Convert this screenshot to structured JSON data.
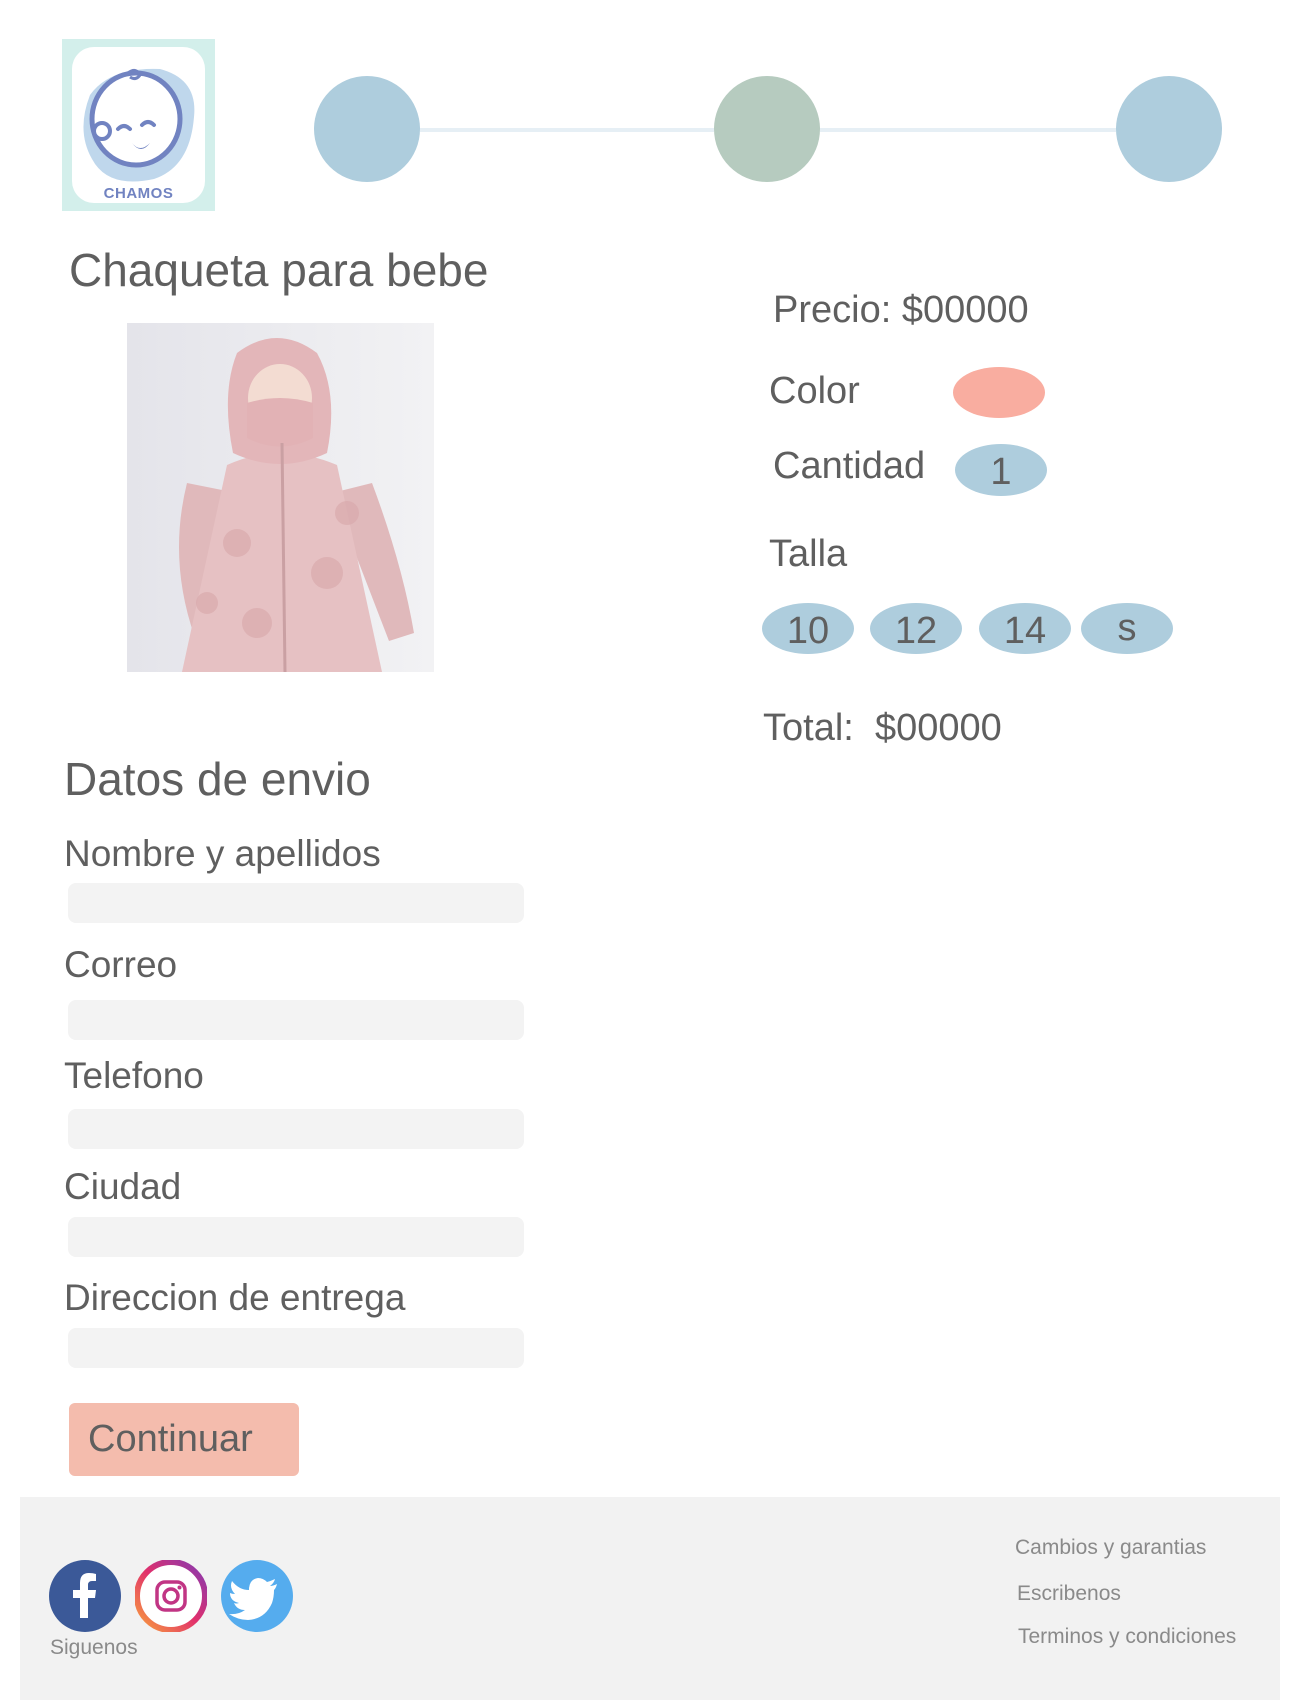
{
  "brand": {
    "logo_text": "CHAMOS"
  },
  "stepper": {
    "steps": [
      {
        "color": "#aecddd"
      },
      {
        "color": "#b6cbbf"
      },
      {
        "color": "#aecddd"
      }
    ]
  },
  "product": {
    "title": "Chaqueta para bebe",
    "price_label": "Precio: $00000",
    "color_label": "Color",
    "selected_color": "#f9ada0",
    "quantity_label": "Cantidad",
    "quantity_value": "1",
    "size_label": "Talla",
    "sizes": [
      "10",
      "12",
      "14",
      "s"
    ],
    "total_label": "Total:  $00000"
  },
  "shipping": {
    "title": "Datos de envio",
    "fields": [
      {
        "label": "Nombre y apellidos",
        "value": ""
      },
      {
        "label": "Correo",
        "value": ""
      },
      {
        "label": "Telefono",
        "value": ""
      },
      {
        "label": "Ciudad",
        "value": ""
      },
      {
        "label": "Direccion de entrega",
        "value": ""
      }
    ],
    "continue_label": "Continuar"
  },
  "footer": {
    "follow_label": "Siguenos",
    "social": [
      {
        "icon": "facebook-icon",
        "color": "#3b5998"
      },
      {
        "icon": "instagram-icon",
        "color": "#c13584"
      },
      {
        "icon": "twitter-icon",
        "color": "#55acee"
      }
    ],
    "links": [
      "Cambios y garantias",
      "Escribenos",
      "Terminos y condiciones"
    ]
  },
  "colors": {
    "pill_blue": "#aecddd",
    "button": "#f4bcad",
    "input_bg": "#f3f3f3",
    "footer_bg": "#f2f2f2"
  }
}
